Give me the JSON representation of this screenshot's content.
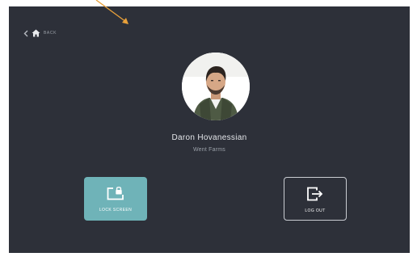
{
  "nav": {
    "back_label": "BACK"
  },
  "profile": {
    "name": "Daron Hovanessian",
    "company": "Went Farms"
  },
  "actions": {
    "lock_label": "LOCK SCREEN",
    "logout_label": "LOG OUT"
  },
  "colors": {
    "background": "#2d3039",
    "accent": "#6fb3b8",
    "annotation_arrow": "#e8a03a"
  },
  "icons": [
    "chevron-left-icon",
    "home-icon",
    "avatar-photo",
    "lock-screen-icon",
    "log-out-icon"
  ]
}
